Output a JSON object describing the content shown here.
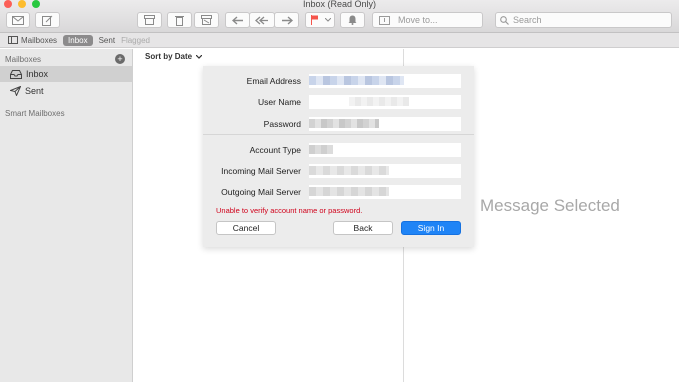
{
  "window": {
    "title": "Inbox (Read Only)"
  },
  "toolbar": {
    "move_to_label": "Move to...",
    "search_placeholder": "Search"
  },
  "favorites": {
    "mailboxes": "Mailboxes",
    "inbox": "Inbox",
    "sent": "Sent",
    "flagged": "Flagged"
  },
  "sidebar": {
    "mailboxes_header": "Mailboxes",
    "add_symbol": "+",
    "items": [
      {
        "label": "Inbox",
        "icon": "tray-icon",
        "selected": true
      },
      {
        "label": "Sent",
        "icon": "paper-plane-icon",
        "selected": false
      }
    ],
    "smart_header": "Smart Mailboxes"
  },
  "message_list": {
    "sort_label": "Sort by Date"
  },
  "reading_pane": {
    "empty_text": "Message Selected"
  },
  "dialog": {
    "email_label": "Email Address",
    "username_label": "User Name",
    "password_label": "Password",
    "account_type_label": "Account Type",
    "incoming_label": "Incoming Mail Server",
    "outgoing_label": "Outgoing Mail Server",
    "error_text": "Unable to verify account name or password.",
    "cancel_label": "Cancel",
    "back_label": "Back",
    "signin_label": "Sign In"
  },
  "colors": {
    "error": "#d0021b",
    "primary_button": "#1f84f6",
    "flag": "#f5544b"
  }
}
